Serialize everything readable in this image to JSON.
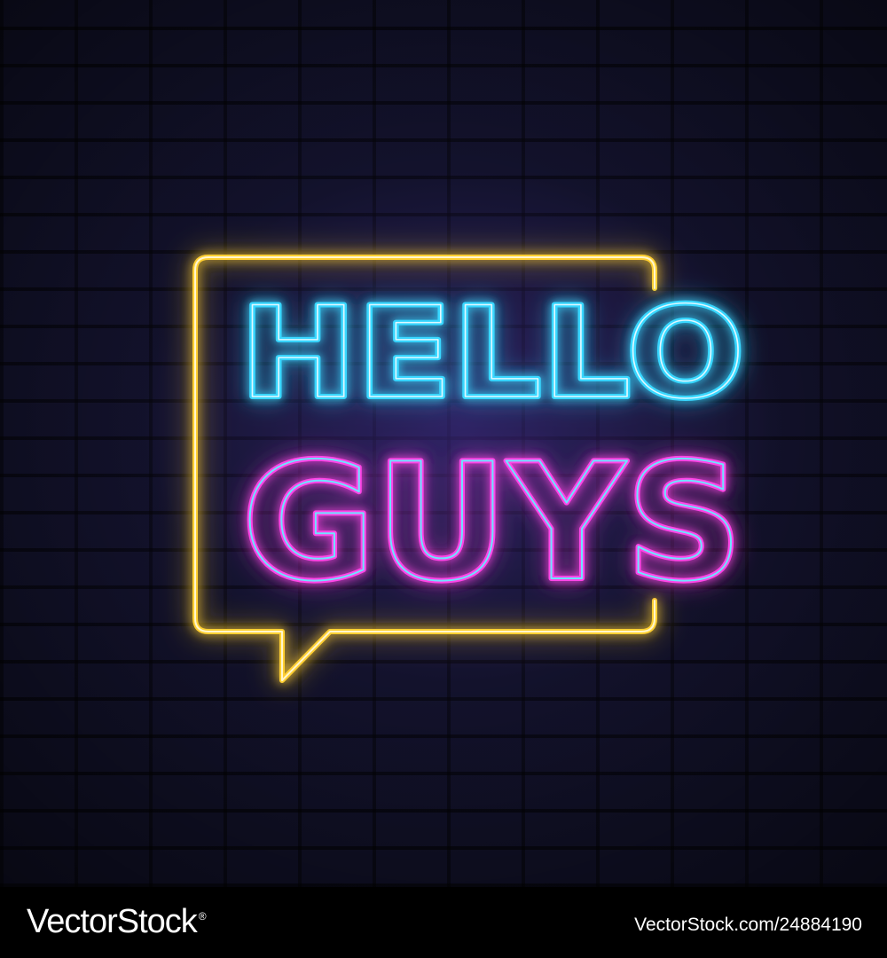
{
  "sign": {
    "line1": "HELLO",
    "line2": "GUYS"
  },
  "colors": {
    "bubble": "#ffcf33",
    "blue_neon": "#39d7ff",
    "pink_neon": "#ff45e6",
    "wall": "#12122a",
    "footer": "#000000"
  },
  "footer": {
    "brand": "VectorStock",
    "brand_mark": "®",
    "image_id": "VectorStock.com/24884190"
  }
}
